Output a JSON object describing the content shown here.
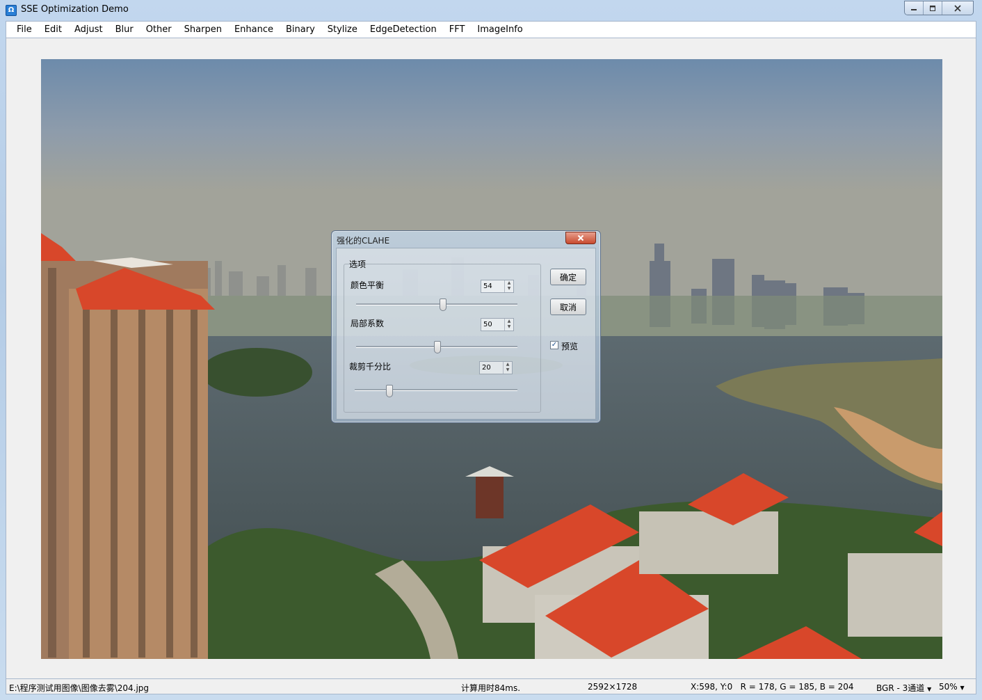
{
  "window": {
    "title": "SSE Optimization Demo",
    "icon": "omega-app-icon",
    "controls": {
      "minimize": "minimize-icon",
      "maximize": "maximize-icon",
      "close": "close-icon"
    }
  },
  "menu": {
    "items": [
      "File",
      "Edit",
      "Adjust",
      "Blur",
      "Other",
      "Sharpen",
      "Enhance",
      "Binary",
      "Stylize",
      "EdgeDetection",
      "FFT",
      "ImageInfo"
    ]
  },
  "dialog": {
    "title": "强化的CLAHE",
    "group_label": "选项",
    "options": [
      {
        "label": "颜色平衡",
        "value": "54"
      },
      {
        "label": "局部系数",
        "value": "50"
      },
      {
        "label": "裁剪千分比",
        "value": "20"
      }
    ],
    "ok_label": "确定",
    "cancel_label": "取消",
    "preview_label": "预览",
    "preview_checked": true
  },
  "status": {
    "file_path": "E:\\程序测试用图像\\图像去雾\\204.jpg",
    "timing": "计算用时84ms.",
    "dimensions": "2592×1728",
    "pixel_info": "X:598, Y:0   R = 178, G = 185, B = 204",
    "channel_mode": "BGR - 3通道",
    "zoom": "50%"
  },
  "colors": {
    "roof_red": "#d8472a",
    "title_gradient": "#c2d7ee",
    "close_red": "#c84a2e"
  }
}
